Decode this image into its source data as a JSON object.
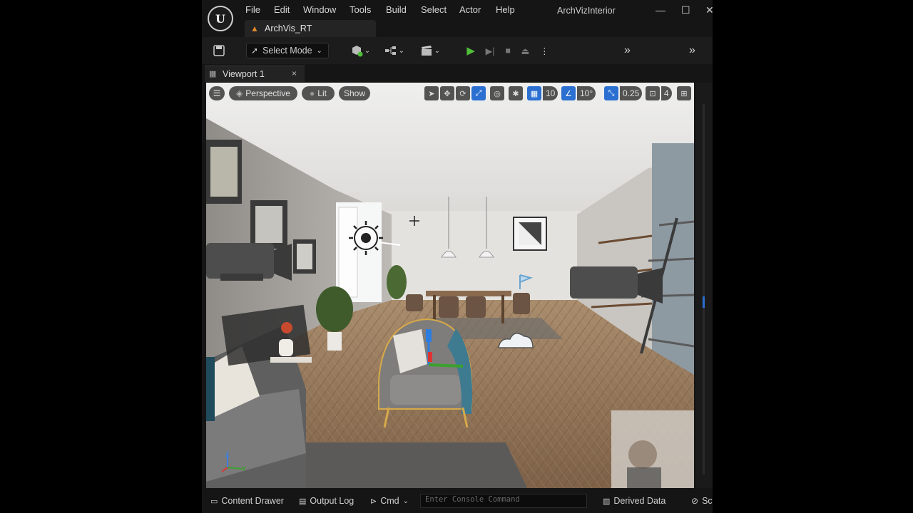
{
  "menubar": {
    "logo": "U",
    "items": [
      "File",
      "Edit",
      "Window",
      "Tools",
      "Build",
      "Select",
      "Actor",
      "Help"
    ],
    "project_title": "ArchVizInterior",
    "window_controls": [
      "—",
      "☐",
      "✕"
    ]
  },
  "project_tab": {
    "label": "ArchVis_RT",
    "icon": "level-icon"
  },
  "toolbar": {
    "select_mode": "Select Mode",
    "play_controls": [
      "play",
      "frame-skip",
      "stop",
      "eject"
    ],
    "accent_play": "#4fbf3a"
  },
  "viewport_tab": {
    "label": "Viewport 1",
    "close": "×"
  },
  "viewport_bar": {
    "perspective": "Perspective",
    "lit": "Lit",
    "show": "Show",
    "grid_snap": "10",
    "rotation_snap": "10°",
    "scale_snap": "0.25",
    "camera_speed": "4",
    "accent": "#2b6fd1"
  },
  "axes": {
    "x": "X",
    "y": "Y",
    "z": "Z"
  },
  "statusbar": {
    "content_drawer": "Content Drawer",
    "output_log": "Output Log",
    "cmd": "Cmd",
    "console_placeholder": "Enter Console Command",
    "derived_data": "Derived Data",
    "source_control": "Sc"
  }
}
